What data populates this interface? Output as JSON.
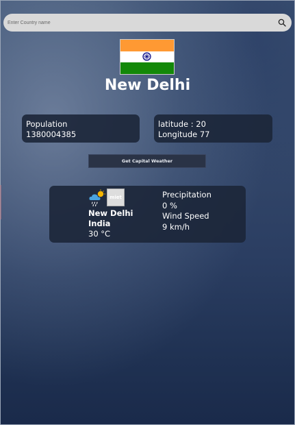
{
  "search": {
    "placeholder": "Enter Country name",
    "icon": "search-icon"
  },
  "country": {
    "flag": "india-flag",
    "flag_colors": [
      "#FF9933",
      "#FFFFFF",
      "#138808",
      "#000080"
    ],
    "capital": "New Delhi",
    "population_label": "Population",
    "population_value": "1380004385",
    "latitude_text": "latitude : 20",
    "longitude_text": "Longitude 77"
  },
  "actions": {
    "weather_button_label": "Get Capital Weather"
  },
  "weather": {
    "icon": "cloud-sun-rain-icon",
    "image_alt": "miet",
    "city": "New Delhi",
    "country": "India",
    "temperature": "30 °C",
    "precipitation_label": "Precipitation",
    "precipitation_value": "0 %",
    "wind_label": "Wind Speed",
    "wind_value": "9 km/h"
  }
}
